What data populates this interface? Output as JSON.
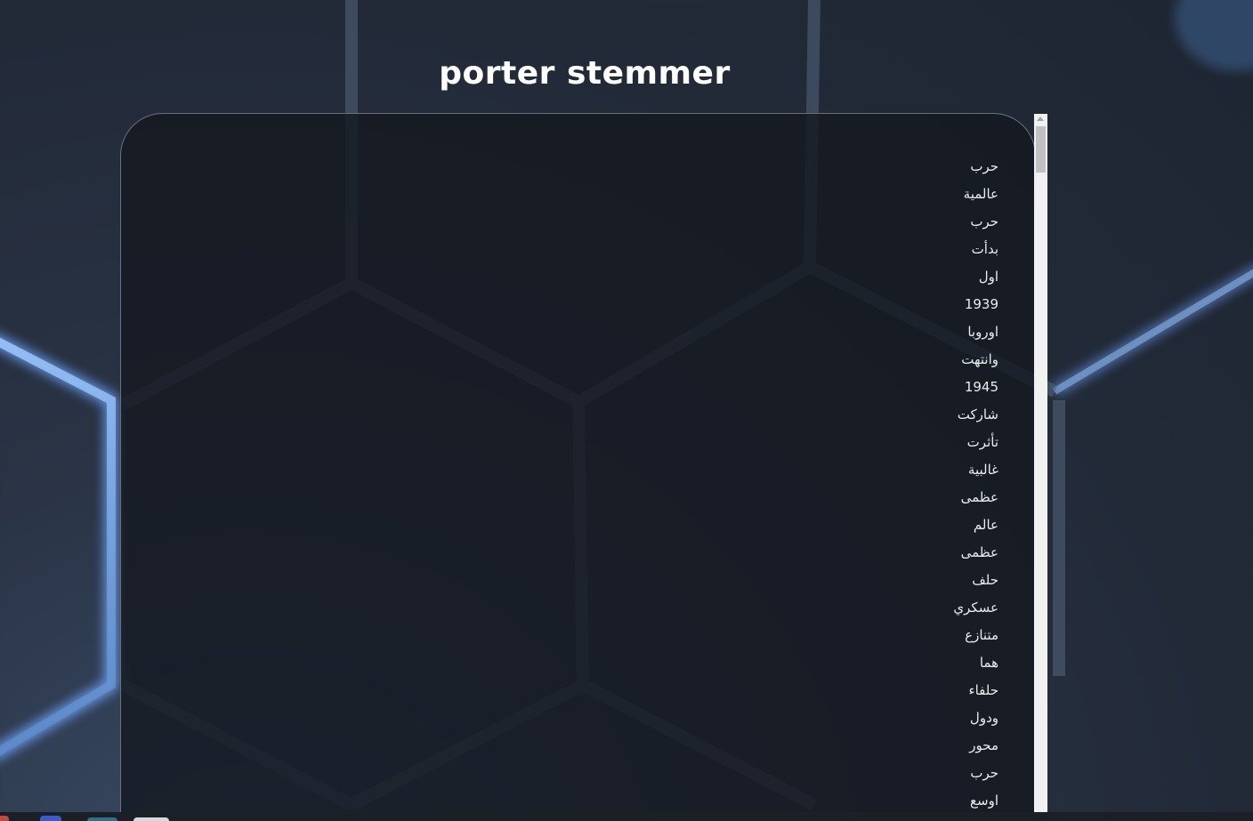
{
  "page": {
    "title": "porter stemmer"
  },
  "words": [
    "حرب",
    "عالمية",
    "حرب",
    "بدأت",
    "اول",
    "1939",
    "اوروبا",
    "وانتهت",
    "1945",
    "شاركت",
    "تأثرت",
    "غالبية",
    "عظمى",
    "عالم",
    "عظمى",
    "حلف",
    "عسكري",
    "متنازع",
    "هما",
    "حلفاء",
    "ودول",
    "محور",
    "حرب",
    "اوسع"
  ],
  "colors": {
    "panel_border": "#6a717c",
    "text": "#e9ecef",
    "hex_glow": "#8fc2ff"
  },
  "taskbar": {
    "icons": [
      "browser-icon",
      "app-icon",
      "app-icon",
      "app-icon"
    ]
  }
}
